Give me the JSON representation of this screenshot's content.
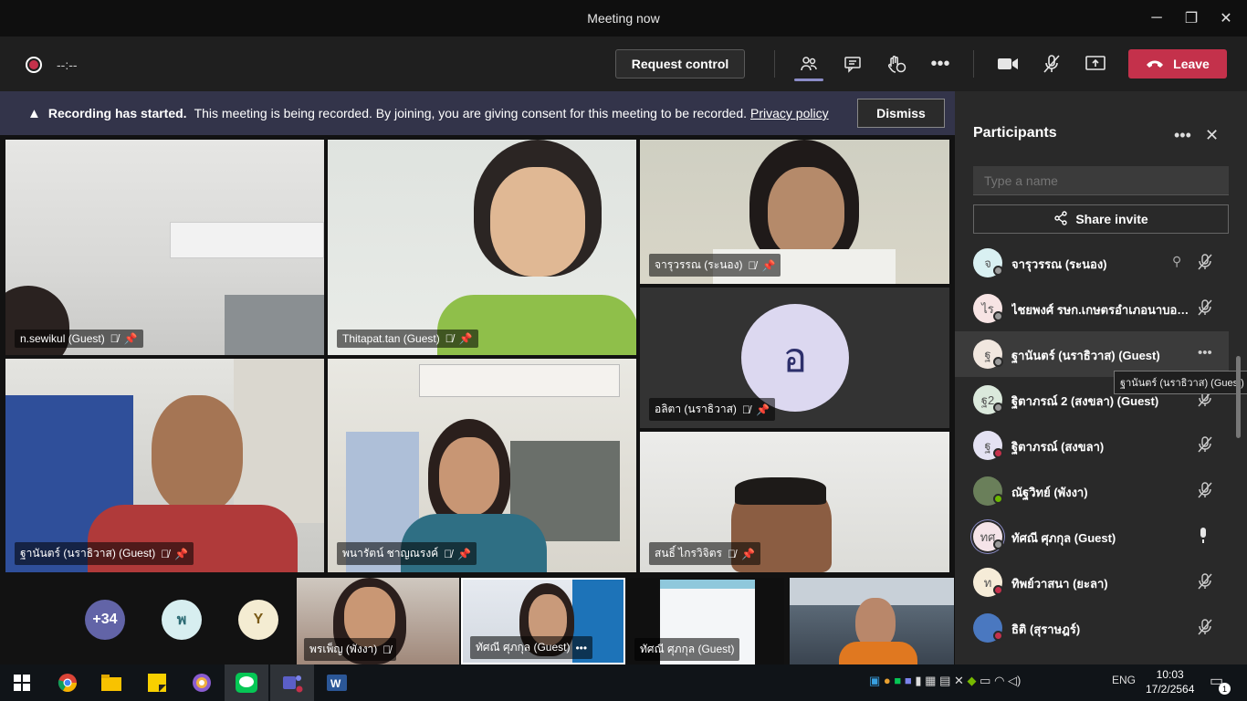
{
  "window": {
    "title": "Meeting now",
    "minimize": "─",
    "maximize": "❐",
    "close": "✕"
  },
  "toolbar": {
    "timer": "--:--",
    "request_control": "Request control",
    "leave": "Leave"
  },
  "banner": {
    "bold": "Recording has started.",
    "text": "This meeting is being recorded. By joining, you are giving consent for this meeting to be recorded.",
    "link": "Privacy policy",
    "dismiss": "Dismiss"
  },
  "tiles": [
    {
      "label": "n.sewikul (Guest)"
    },
    {
      "label": "Thitapat.tan (Guest)"
    },
    {
      "label": "จารุวรรณ (ระนอง)"
    },
    {
      "label": "อลิตา (นราธิวาส)",
      "initial": "อ"
    },
    {
      "label": "ฐานันตร์ (นราธิวาส) (Guest)"
    },
    {
      "label": "พนารัตน์ ชาญณรงค์"
    },
    {
      "label": "สนธิ์ ไกรวิจิตร"
    }
  ],
  "overflow": [
    {
      "text": "+34",
      "color": "#6264a7"
    },
    {
      "text": "พ",
      "color": "#d7eef0"
    },
    {
      "text": "Y",
      "color": "#f4ecd2"
    }
  ],
  "strip": [
    {
      "label": "พรเพ็ญ (พังงา)"
    },
    {
      "label": "ทัศณี ศุภกุล (Guest)"
    },
    {
      "label": "ทัศณี ศุภกุล (Guest)"
    },
    {
      "label": ""
    }
  ],
  "panel": {
    "title": "Participants",
    "search_placeholder": "Type a name",
    "share_invite": "Share invite",
    "tooltip": "ฐานันตร์ (นราธิวาส) (Guest)",
    "participants": [
      {
        "initial": "จ",
        "name": "จารุวรรณ (ระนอง)",
        "bg": "#d9f0f2",
        "status": "#999999"
      },
      {
        "initial": "ไร",
        "name": "ไชยพงศ์ รษก.เกษตรอำเภอนาบอน ...",
        "bg": "#f7e4e4",
        "status": "#999999"
      },
      {
        "initial": "ฐ",
        "name": "ฐานันตร์ (นราธิวาส) (Guest)",
        "bg": "#f1e7df",
        "status": "#999999"
      },
      {
        "initial": "ฐ2",
        "name": "ฐิตาภรณ์ 2 (สงขลา) (Guest)",
        "bg": "#dbe9dc",
        "status": "#999999"
      },
      {
        "initial": "ฐ",
        "name": "ฐิตาภรณ์ (สงขลา)",
        "bg": "#e4e2f3",
        "status": "#c4314b"
      },
      {
        "initial": "",
        "name": "ณัฐวิทย์ (พังงา)",
        "bg": "#6a7f5a",
        "status": "#6bb700"
      },
      {
        "initial": "ทศ",
        "name": "ทัศณี ศุภกุล (Guest)",
        "bg": "#f5e4e9",
        "status": "#999999"
      },
      {
        "initial": "ท",
        "name": "ทิพย์วาสนา (ยะลา)",
        "bg": "#f6ecd8",
        "status": "#c4314b"
      },
      {
        "initial": "",
        "name": "ธิติ (สุราษฎร์)",
        "bg": "#4a78c0",
        "status": "#c4314b"
      }
    ]
  },
  "taskbar": {
    "lang": "ENG",
    "time": "10:03",
    "date": "17/2/2564",
    "notif_count": "1"
  }
}
